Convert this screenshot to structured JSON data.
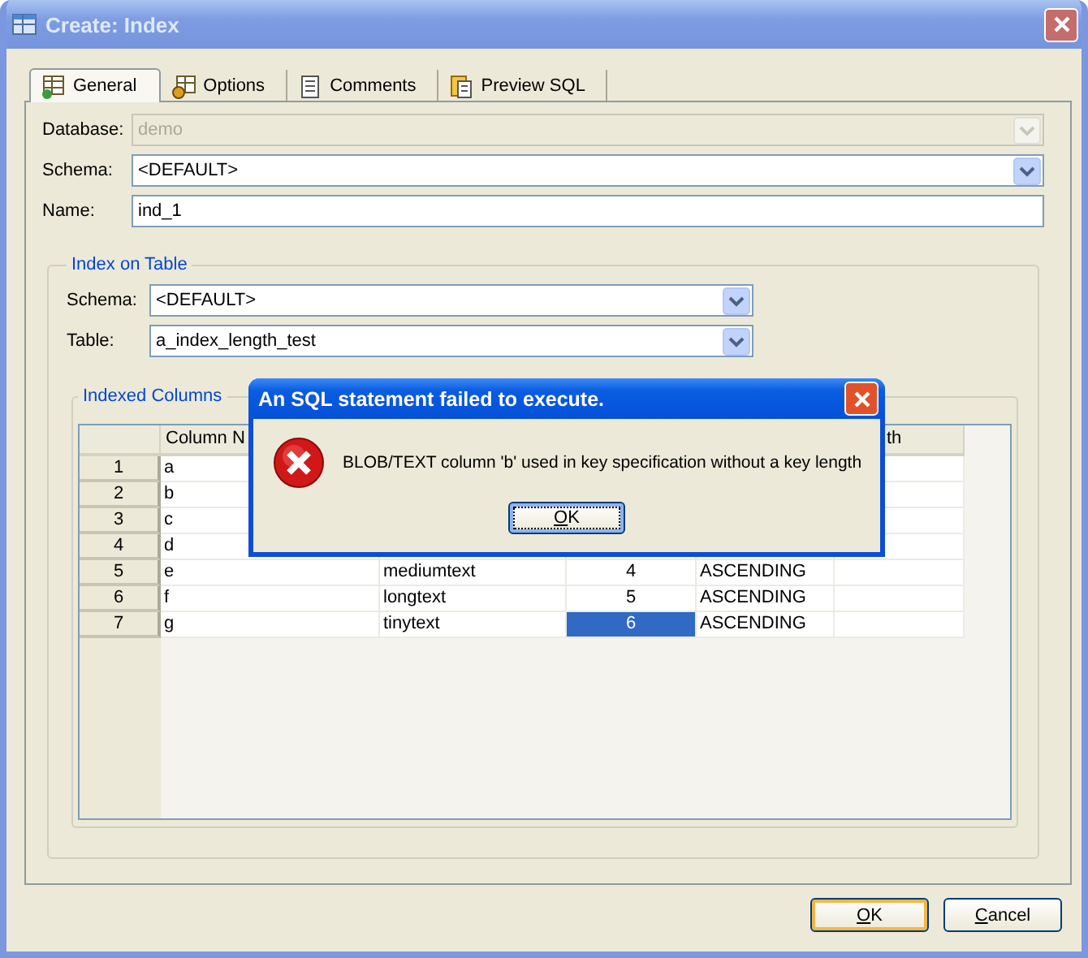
{
  "window": {
    "title": "Create: Index"
  },
  "tabs": [
    {
      "label": "General",
      "kind": "table",
      "selected": true
    },
    {
      "label": "Options",
      "kind": "gear",
      "selected": false
    },
    {
      "label": "Comments",
      "kind": "note",
      "selected": false
    },
    {
      "label": "Preview SQL",
      "kind": "script",
      "selected": false
    }
  ],
  "general": {
    "database": {
      "label": "Database:",
      "value": "demo",
      "disabled": true
    },
    "schema": {
      "label": "Schema:",
      "value": "<DEFAULT>",
      "disabled": false
    },
    "name": {
      "label": "Name:",
      "value": "ind_1"
    }
  },
  "index_on_table": {
    "title": "Index on Table",
    "schema": {
      "label": "Schema:",
      "value": "<DEFAULT>"
    },
    "table": {
      "label": "Table:",
      "value": "a_index_length_test"
    }
  },
  "indexed_columns": {
    "title": "Indexed Columns",
    "headers": {
      "column_1": "Column N",
      "column_5": "th"
    },
    "rows": [
      {
        "number": "1",
        "column_1": "a"
      },
      {
        "number": "2",
        "column_1": "b"
      },
      {
        "number": "3",
        "column_1": "c"
      },
      {
        "number": "4",
        "column_1": "d"
      },
      {
        "number": "5",
        "column_1": "e",
        "column_2": "mediumtext",
        "column_3": "4",
        "column_4": "ASCENDING",
        "selected": false
      },
      {
        "number": "6",
        "column_1": "f",
        "column_2": "longtext",
        "column_3": "5",
        "column_4": "ASCENDING",
        "selected": false
      },
      {
        "number": "7",
        "column_1": "g",
        "column_2": "tinytext",
        "column_3": "6",
        "column_4": "ASCENDING",
        "selected": true
      }
    ]
  },
  "error_dialog": {
    "title": "An SQL statement failed to execute.",
    "message": "BLOB/TEXT column 'b' used in key specification without a key length",
    "button": {
      "label": "OK",
      "focused": true
    }
  },
  "buttons": [
    {
      "label": "OK",
      "default": true
    },
    {
      "label": "Cancel",
      "default": false
    }
  ]
}
